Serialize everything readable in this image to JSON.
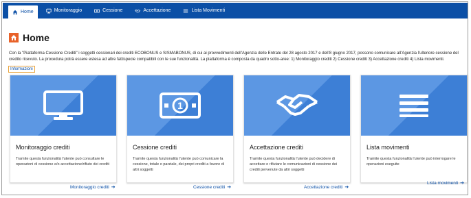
{
  "nav": {
    "items": [
      {
        "label": "Home",
        "icon": "home-icon"
      },
      {
        "label": "Monitoraggio",
        "icon": "monitor-icon"
      },
      {
        "label": "Cessione",
        "icon": "money-icon"
      },
      {
        "label": "Accettazione",
        "icon": "handshake-icon"
      },
      {
        "label": "Lista Movimenti",
        "icon": "list-icon"
      }
    ],
    "active_index": 0
  },
  "page": {
    "title": "Home",
    "intro": "Con la \"Piattaforma Cessione Crediti\" i soggetti cessionari dei crediti ECOBONUS e SISMABONUS, di cui ai provvedimenti dell'Agenzia delle Entrate del 28 agosto 2017 e dell'8 giugno 2017, possono comunicare all'Agenzia l'ulteriore cessione del credito ricevuto. La procedura potrà essere estesa ad altre fattispecie compatibili con le sue funzionalità. La piattaforma è composta da quadro sotto-aree: 1) Monitoraggio crediti 2) Cessione crediti 3) Accettazione crediti 4) Lista movimenti.",
    "info_link": "Informazioni"
  },
  "cards": [
    {
      "title": "Monitoraggio crediti",
      "description": "Tramite questa funzionalità l'utente può consultare le operazioni di cessione e/o accettazione/rifiuto dei crediti",
      "link": "Monitoraggio crediti",
      "icon": "monitor-icon"
    },
    {
      "title": "Cessione crediti",
      "description": "Tramite questa funzionalità l'utente può comunicare la cessione, totale o parziale, dei propri crediti a favore di altri soggetti",
      "link": "Cessione crediti",
      "icon": "money-icon"
    },
    {
      "title": "Accettazione crediti",
      "description": "Tramite questa funzionalità l'utente può decidere di accettare o rifiutare le comunicazioni di cessione dei crediti pervenute da altri soggetti",
      "link": "Accettazione crediti",
      "icon": "handshake-icon"
    },
    {
      "title": "Lista movimenti",
      "description": "Tramite questa funzionalità l'utente può interrogare le operazioni eseguite",
      "link": "Lista movimenti",
      "icon": "list-icon"
    }
  ],
  "colors": {
    "nav_bg": "#0b4fa6",
    "accent_orange": "#e8622a",
    "card_blue": "#3d7fd6",
    "link": "#0b4fa6"
  }
}
